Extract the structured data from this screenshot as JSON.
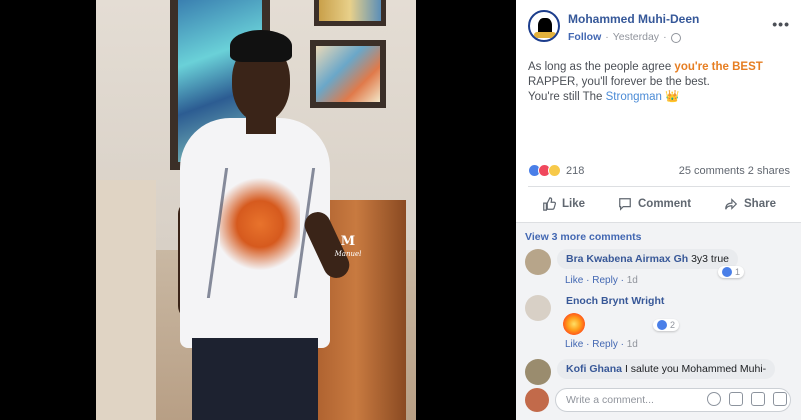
{
  "post": {
    "author": "Mohammed Muhi-Deen",
    "follow_label": "Follow",
    "separator": "·",
    "time": "Yesterday",
    "more_label": "•••",
    "text_line1_pre": "As long as the people agree ",
    "text_line1_hl": "you're the BEST",
    "text_line2": "RAPPER, you'll forever be the best.",
    "text_line3_pre": "You're still The ",
    "text_line3_hl": "Strongman",
    "crown": "👑"
  },
  "photo": {
    "watermark_big": "M",
    "watermark_small": "Manuel"
  },
  "stats": {
    "reaction_count": "218",
    "comments": "25 comments",
    "shares": "2 shares"
  },
  "actions": {
    "like": "Like",
    "comment": "Comment",
    "share": "Share"
  },
  "comments": {
    "view_more": "View 3 more comments",
    "items": [
      {
        "name": "Bra Kwabena Airmax Gh",
        "text": "3y3 true",
        "like": "Like",
        "reply": "Reply",
        "time": "1d",
        "likes": "1"
      },
      {
        "name": "Enoch Brynt Wright",
        "text": "",
        "like": "Like",
        "reply": "Reply",
        "time": "1d",
        "likes": "2"
      },
      {
        "name": "Kofi Ghana",
        "text": "I salute you Mohammed Muhi-",
        "like": "",
        "reply": "",
        "time": "",
        "likes": ""
      }
    ]
  },
  "write": {
    "placeholder": "Write a comment..."
  },
  "colors": {
    "link_blue": "#365899",
    "accent_orange": "#e67e22",
    "like_blue": "#4a7fe8"
  }
}
